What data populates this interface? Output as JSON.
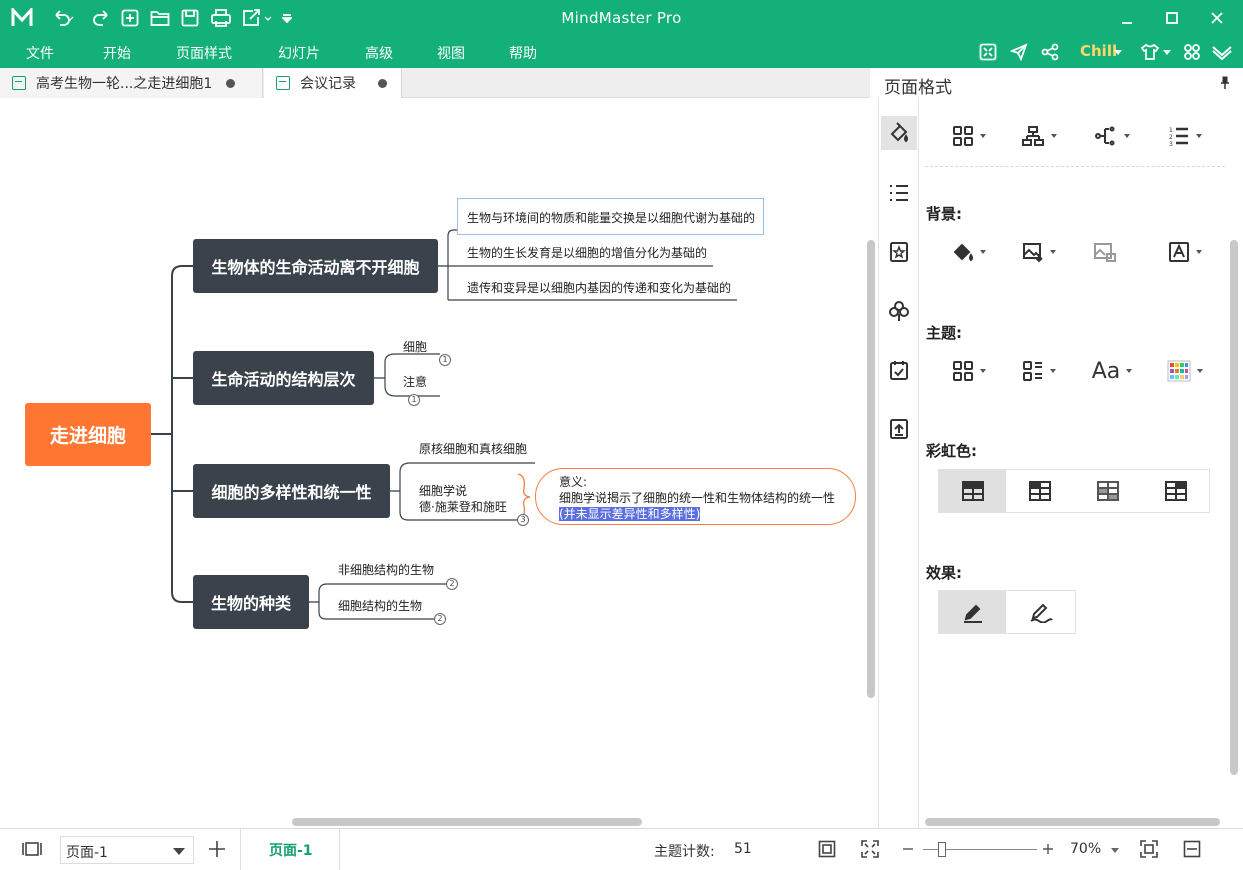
{
  "app": {
    "title": "MindMaster Pro"
  },
  "menu": [
    "文件",
    "开始",
    "页面样式",
    "幻灯片",
    "高级",
    "视图",
    "帮助"
  ],
  "menu_right": {
    "theme_label": "Chill"
  },
  "tabs": [
    {
      "label": "高考生物一轮...之走进细胞1"
    },
    {
      "label": "会议记录"
    }
  ],
  "mindmap": {
    "central": "走进细胞",
    "branches": [
      {
        "label": "生物体的生命活动离不开细胞",
        "children": [
          "生物与环境间的物质和能量交换是以细胞代谢为基础的",
          "生物的生长发育是以细胞的增值分化为基础的",
          "遗传和变异是以细胞内基因的传递和变化为基础的"
        ]
      },
      {
        "label": "生命活动的结构层次",
        "children": [
          "细胞",
          "注意"
        ],
        "badges": [
          "1",
          "1"
        ]
      },
      {
        "label": "细胞的多样性和统一性",
        "children": [
          "原核细胞和真核细胞",
          "细胞学说",
          "德·施莱登和施旺"
        ],
        "badges": [
          "3"
        ]
      },
      {
        "label": "生物的种类",
        "children": [
          "非细胞结构的生物",
          "细胞结构的生物"
        ],
        "badges": [
          "2",
          "2"
        ]
      }
    ],
    "callout": {
      "line1": "意义:",
      "line2": "细胞学说揭示了细胞的统一性和生物体结构的统一性",
      "line3": "(并未显示差异性和多样性)"
    }
  },
  "panel": {
    "title": "页面格式",
    "sections": {
      "background": "背景:",
      "theme": "主题:",
      "rainbow": "彩虹色:",
      "effect": "效果:"
    }
  },
  "status": {
    "page_select": "页面-1",
    "page_tab": "页面-1",
    "topic_count_label": "主题计数:",
    "topic_count": "51",
    "zoom": "70%"
  }
}
